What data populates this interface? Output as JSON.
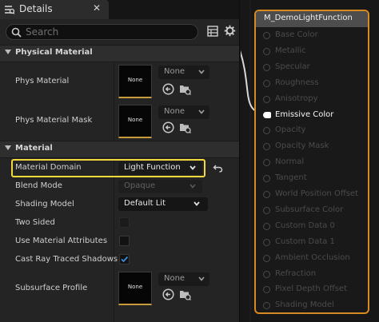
{
  "details": {
    "tab_title": "Details",
    "close_glyph": "✕",
    "search_placeholder": "Search",
    "icons": {
      "tab": "details-icon",
      "search": "search-icon",
      "table": "table-view-icon",
      "settings": "gear-icon"
    }
  },
  "sections": {
    "physical_material": {
      "title": "Physical Material",
      "rows": [
        {
          "label": "Phys Material",
          "thumb_text": "None",
          "combo": "None"
        },
        {
          "label": "Phys Material Mask",
          "thumb_text": "None",
          "combo": "None"
        }
      ]
    },
    "material": {
      "title": "Material",
      "material_domain": {
        "label": "Material Domain",
        "value": "Light Function"
      },
      "blend_mode": {
        "label": "Blend Mode",
        "value": "Opaque"
      },
      "shading_model": {
        "label": "Shading Model",
        "value": "Default Lit"
      },
      "two_sided": {
        "label": "Two Sided",
        "checked": false
      },
      "use_material_attributes": {
        "label": "Use Material Attributes",
        "checked": false
      },
      "cast_ray_traced_shadows": {
        "label": "Cast Ray Traced Shadows",
        "checked": true
      },
      "subsurface_profile": {
        "label": "Subsurface Profile",
        "thumb_text": "None",
        "combo": "None"
      }
    }
  },
  "node": {
    "title": "M_DemoLightFunction",
    "header_color": "#4d4d4d",
    "border_color": "#d88a1f",
    "pins": [
      {
        "label": "Base Color",
        "active": false
      },
      {
        "label": "Metallic",
        "active": false
      },
      {
        "label": "Specular",
        "active": false
      },
      {
        "label": "Roughness",
        "active": false
      },
      {
        "label": "Anisotropy",
        "active": false
      },
      {
        "label": "Emissive Color",
        "active": true
      },
      {
        "label": "Opacity",
        "active": false
      },
      {
        "label": "Opacity Mask",
        "active": false
      },
      {
        "label": "Normal",
        "active": false
      },
      {
        "label": "Tangent",
        "active": false
      },
      {
        "label": "World Position Offset",
        "active": false
      },
      {
        "label": "Subsurface Color",
        "active": false
      },
      {
        "label": "Custom Data 0",
        "active": false
      },
      {
        "label": "Custom Data 1",
        "active": false
      },
      {
        "label": "Ambient Occlusion",
        "active": false
      },
      {
        "label": "Refraction",
        "active": false
      },
      {
        "label": "Pixel Depth Offset",
        "active": false
      },
      {
        "label": "Shading Model",
        "active": false
      }
    ]
  },
  "colors": {
    "accent_yellow": "#f0d93c",
    "check_blue": "#3a8dde",
    "thumb_underline": "#c89b3c"
  }
}
